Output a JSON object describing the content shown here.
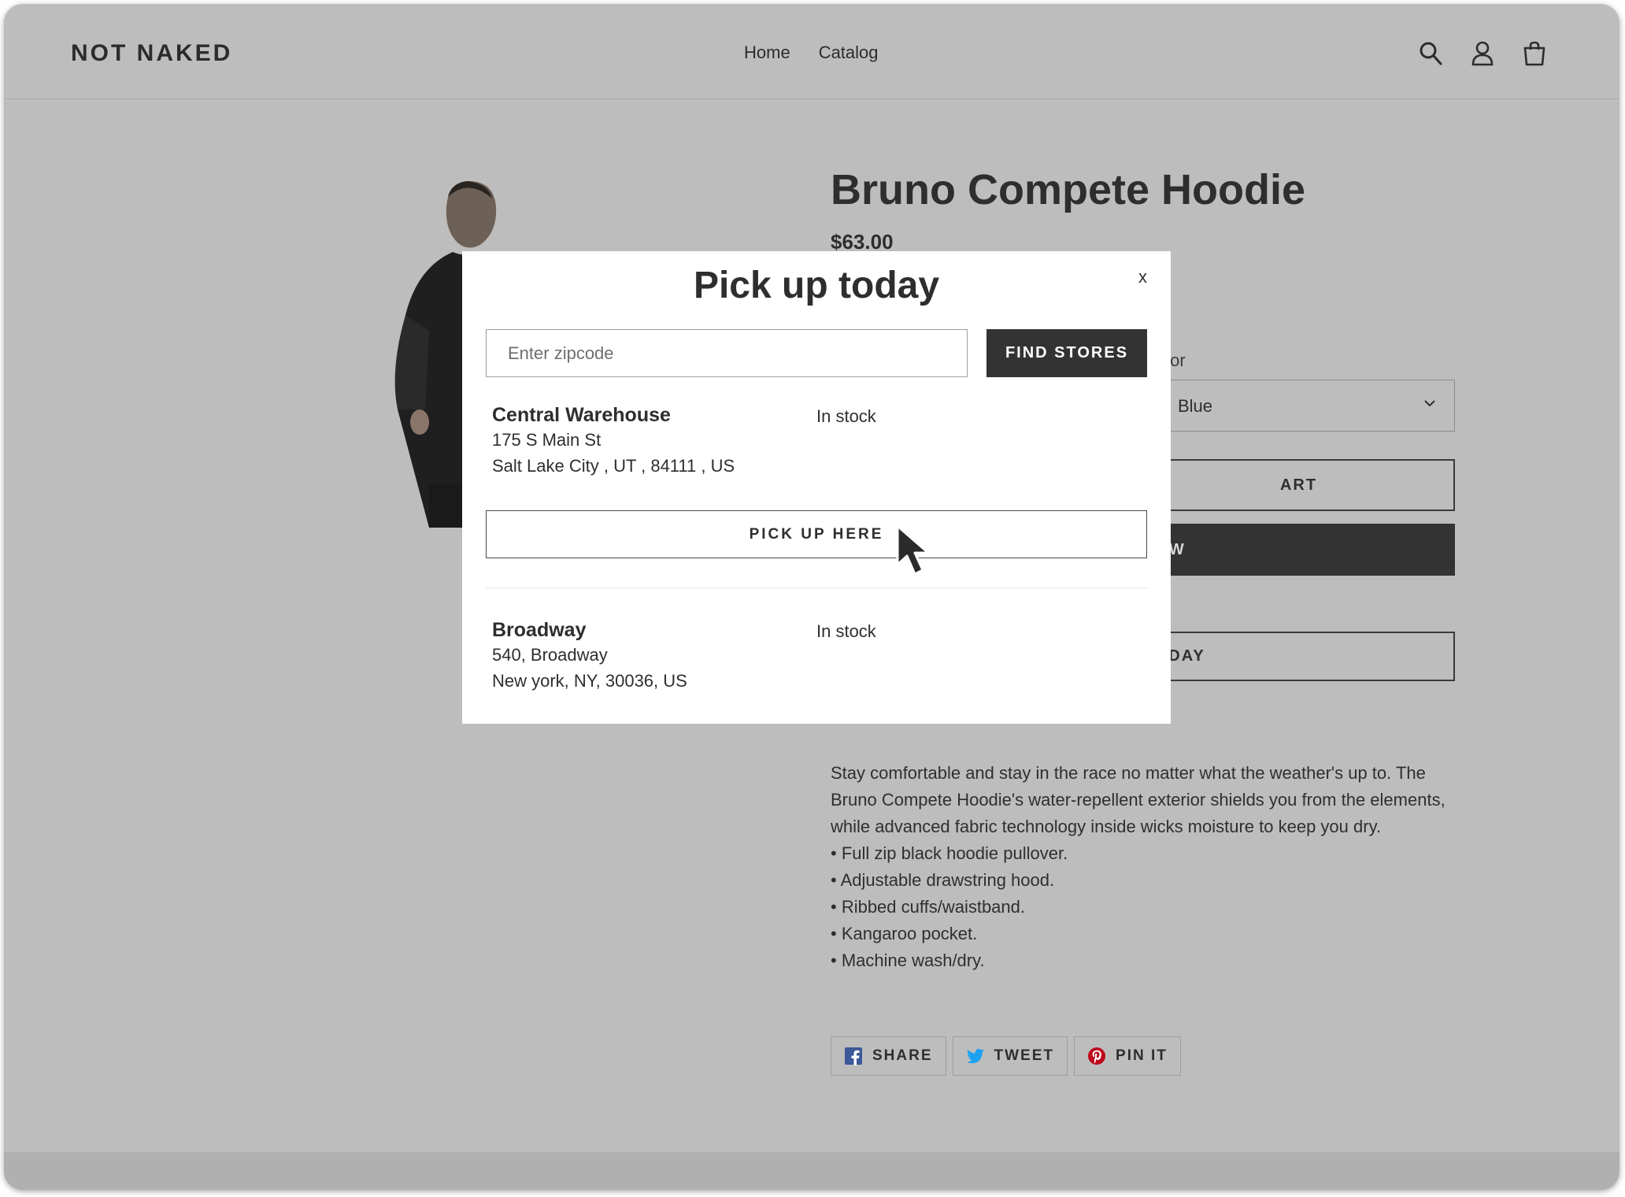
{
  "header": {
    "logo": "NOT NAKED",
    "nav": [
      "Home",
      "Catalog"
    ],
    "icons": [
      "search-icon",
      "account-icon",
      "cart-icon"
    ]
  },
  "product": {
    "title": "Bruno Compete Hoodie",
    "price": "$63.00",
    "color_label_partial": "olor",
    "color_value": "Blue",
    "add_to_cart_partial": "ART",
    "buy_now_partial": "OW",
    "pickup_today_partial": "DAY",
    "description": "Stay comfortable and stay in the race no matter what the weather's up to. The Bruno Compete Hoodie's water-repellent exterior shields you from the elements, while advanced fabric technology inside wicks moisture to keep you dry.",
    "bullets": [
      "• Full zip black hoodie pullover.",
      "• Adjustable drawstring hood.",
      "• Ribbed cuffs/waistband.",
      "• Kangaroo pocket.",
      "• Machine wash/dry."
    ]
  },
  "social": [
    {
      "label": "SHARE",
      "icon": "facebook-icon",
      "color": "#3b5998"
    },
    {
      "label": "TWEET",
      "icon": "twitter-icon",
      "color": "#1da1f2"
    },
    {
      "label": "PIN IT",
      "icon": "pinterest-icon",
      "color": "#bd081c"
    }
  ],
  "modal": {
    "title": "Pick up today",
    "close": "x",
    "zip_placeholder": "Enter zipcode",
    "find_label": "FIND STORES",
    "pickup_label": "PICK UP HERE",
    "stores": [
      {
        "name": "Central Warehouse",
        "line1": "175 S Main St",
        "line2": "Salt Lake City , UT , 84111 , US",
        "status": "In stock"
      },
      {
        "name": "Broadway",
        "line1": "540, Broadway",
        "line2": "New york, NY, 30036, US",
        "status": "In stock"
      }
    ]
  },
  "colors": {
    "overlay_bg": "#bdbdbd",
    "dark_button": "#333333",
    "modal_bg": "#ffffff"
  }
}
